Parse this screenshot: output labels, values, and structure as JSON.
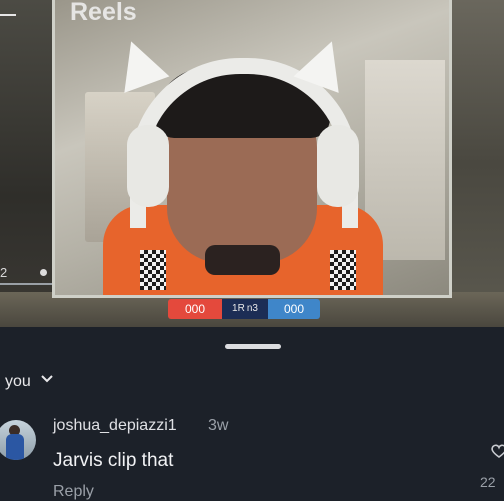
{
  "video": {
    "title": "Reels",
    "left_counter": "2",
    "scoreboard": {
      "left": "000",
      "middle": "1R n3",
      "right": "000"
    }
  },
  "comments": {
    "sort_label": "you",
    "items": [
      {
        "username": "joshua_depiazzi1",
        "timestamp": "3w",
        "text": "Jarvis clip that",
        "reply_label": "Reply",
        "like_count": "22"
      }
    ]
  },
  "colors": {
    "sheet_bg": "#1c2129",
    "score_red": "#e4493c",
    "score_blue": "#3f86c9"
  },
  "icons": {
    "sort": "chevron-down-icon",
    "like": "heart-icon",
    "back": "minus-icon"
  }
}
